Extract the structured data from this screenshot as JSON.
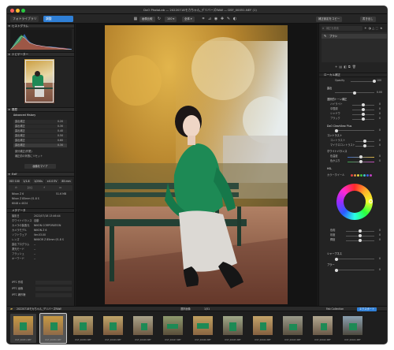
{
  "window": {
    "title": "DxO PhotoLab — 20220718モカちゃん_デリバーズRAW — DSF_00051.NEF (1)"
  },
  "tabs": {
    "library": "フォトライブラリ",
    "customize": "調整"
  },
  "toolbar": {
    "compare": "画像比較",
    "zoom": "100 ▾",
    "fit": "全体 ▾",
    "export_preset": "補正設定をコピー",
    "export": "書き出し"
  },
  "left_panel": {
    "histogram_title": "ヒストグラム",
    "navigator_title": "ナビゲーター",
    "history_title": "履歴",
    "history_tab": "Advanced History",
    "history_items": [
      {
        "label": "露出補正",
        "value": "0.20"
      },
      {
        "label": "露出補正",
        "value": "0.30"
      },
      {
        "label": "露出補正",
        "value": "0.40"
      },
      {
        "label": "露出補正",
        "value": "0.50"
      },
      {
        "label": "露出補正",
        "value": "0.60"
      },
      {
        "label": "露出補正",
        "value": "0.30"
      }
    ],
    "history_extra": [
      "部分補正(作業)",
      "補正前の状態にリセット"
    ],
    "apply_button": "画像をマイア",
    "exif_title": "Exif",
    "exif_chips": [
      "ISO 100",
      "1/1.8",
      "1/250s",
      "±0.0 EV",
      "85 mm"
    ],
    "camera_line": "Nikon Z 6",
    "lens_line": "Nikon Z 85mm f/1.8 S",
    "size_line": "6048 x 4024",
    "size_right": "51.6 MB",
    "meta_section": "メタデータ",
    "meta_rows": [
      {
        "label": "撮影日",
        "value": "2022/07/18 13:46:44"
      },
      {
        "label": "ホワイトバランス",
        "value": "自動"
      },
      {
        "label": "カメラの製造元",
        "value": "NIKON CORPORATION"
      },
      {
        "label": "カメラモデル",
        "value": "NIKON Z 6"
      },
      {
        "label": "ソフトウェア",
        "value": "Ver.03.00"
      },
      {
        "label": "レンズ",
        "value": "NIKKOR Z 85mm f/1.8 S"
      },
      {
        "label": "露出プログラム",
        "value": "--"
      },
      {
        "label": "測光モード",
        "value": "--"
      },
      {
        "label": "フラッシュ",
        "value": "--"
      },
      {
        "label": "キーワード",
        "value": "--"
      }
    ],
    "iptc_rows": [
      "IPTC 作成",
      "IPTC 画像",
      "IPTC 著作権"
    ]
  },
  "right_panel": {
    "search_placeholder": "補正を検索",
    "mask_tool": "ブラシ",
    "local_adjust_title": "ローカル補正",
    "opacity_label": "Opacity",
    "opacity_value": "100",
    "exposure_label": "露出",
    "exposure_value": "0.00",
    "tone_title": "選択的トーン補正",
    "tone_rows": [
      {
        "label": "ハイライト",
        "value": "0"
      },
      {
        "label": "中間調",
        "value": "0"
      },
      {
        "label": "シャドウ",
        "value": "0"
      },
      {
        "label": "ブラック",
        "value": "0"
      }
    ],
    "clearview_label": "DxO ClearView Plus",
    "clearview_value": "0",
    "contrast_title": "コントラスト",
    "contrast_rows": [
      {
        "label": "コントラスト",
        "value": "0"
      },
      {
        "label": "マイクロコントラスト",
        "value": "0"
      }
    ],
    "wb_title": "ホワイトバランス",
    "wb_rows": [
      {
        "label": "色温度",
        "value": "0"
      },
      {
        "label": "色かぶり",
        "value": "0"
      }
    ],
    "hsl_title": "HSL",
    "hsl_mode": "カラーホイール",
    "hsl_rows": [
      {
        "label": "色相",
        "value": "0"
      },
      {
        "label": "彩度",
        "value": "0"
      },
      {
        "label": "輝度",
        "value": "0"
      }
    ],
    "sharp_title": "シャープネス",
    "sharp_value": "0",
    "blur_title": "ブラー",
    "blur_value": "0"
  },
  "filmbar": {
    "folder": "20220718モカちゃん_デリバーズRAW",
    "selection": "選択画像",
    "count": "1/51",
    "filter": "Fab Collection",
    "export_label": "エクスポート"
  },
  "thumbnails": [
    "DSF_00051.NEF",
    "DSF_00050.NEF",
    "DSF_00050.NEF",
    "DSF_00049.NEF",
    "DSF_00048.NEF",
    "DSF_00047.NEF",
    "DSF_00046.NEF",
    "DSF_00045.NEF",
    "DSF_00044.NEF",
    "DSF_00043.NEF",
    "DSF_00042.NEF",
    "DSF_00041.NEF"
  ],
  "colors": {
    "accent": "#2f7fd6",
    "panel": "#232323",
    "background": "#1c1c1c"
  }
}
